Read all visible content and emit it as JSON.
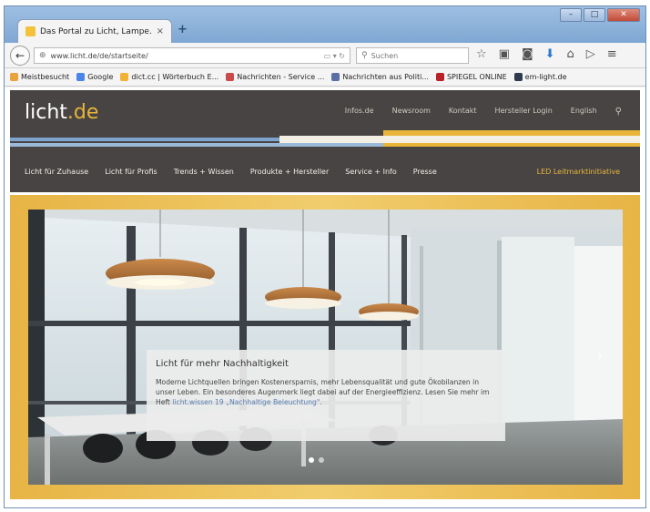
{
  "browser": {
    "tab_title": "Das Portal zu Licht, Lampe...",
    "tab_close": "×",
    "new_tab": "+",
    "url": "www.licht.de/de/startseite/",
    "search_placeholder": "Suchen",
    "window_controls": {
      "minimize": "–",
      "maximize": "□",
      "close": "✕"
    },
    "bookmarks": [
      {
        "label": "Meistbesucht",
        "color": "#e8a33a"
      },
      {
        "label": "Google",
        "color": "#4a86e8"
      },
      {
        "label": "dict.cc | Wörterbuch E...",
        "color": "#f3b234"
      },
      {
        "label": "Nachrichten - Service ...",
        "color": "#c94b4b"
      },
      {
        "label": "Nachrichten aus Politi...",
        "color": "#5a6fa8"
      },
      {
        "label": "SPIEGEL ONLINE",
        "color": "#b8202a"
      },
      {
        "label": "em-light.de",
        "color": "#2e3b4e"
      }
    ]
  },
  "site": {
    "logo_main": "licht",
    "logo_dot": ".de",
    "topnav": [
      "Infos.de",
      "Newsroom",
      "Kontakt",
      "Hersteller Login",
      "English"
    ],
    "mainnav": [
      "Licht für Zuhause",
      "Licht für Profis",
      "Trends + Wissen",
      "Produkte + Hersteller",
      "Service + Info",
      "Presse"
    ],
    "mainnav_accent": "LED Leitmarktinitiative",
    "colors": {
      "header": "#474443",
      "accent": "#e8b53a",
      "frame": "#f1cd6d"
    }
  },
  "hero": {
    "title": "Licht für mehr Nachhaltigkeit",
    "body": "Moderne Lichtquellen bringen Kostenersparnis, mehr Lebensqualität und gute Ökobilanzen in unser Leben. Ein besonderes Augenmerk liegt dabei auf der Energieeffizienz. Lesen Sie mehr im Heft",
    "link": "licht.wissen 19 „Nachhaltige Beleuchtung\".",
    "slides": 2,
    "active_slide": 1
  }
}
